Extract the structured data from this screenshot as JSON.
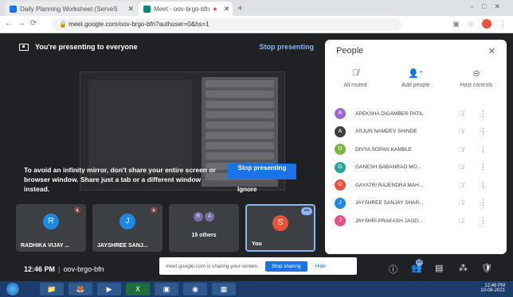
{
  "browser": {
    "tabs": [
      {
        "label": "Daily Planning Worksheet (ServeS"
      },
      {
        "label": "Meet - oov-brgo-bfn"
      }
    ],
    "url": "meet.google.com/oov-brgo-bfn?authuser=0&hs=1"
  },
  "meet": {
    "presenting_text": "You're presenting to everyone",
    "stop_presenting_label": "Stop presenting",
    "mirror_warning": "To avoid an infinity mirror, don't share your entire screen or browser window. Share just a tab or a different window instead.",
    "stop_button": "Stop presenting",
    "ignore_label": "Ignore",
    "tiles": [
      {
        "initial": "R",
        "name": "RADHIKA VIJAY ...",
        "color": "#1e88e5"
      },
      {
        "initial": "J",
        "name": "JAYSHREE SANJ...",
        "color": "#1e88e5"
      },
      {
        "others": "15 others",
        "mini": [
          "R",
          "A"
        ]
      },
      {
        "initial": "S",
        "name": "You",
        "color": "#e8533a"
      }
    ],
    "time": "12:46 PM",
    "meeting_code": "oov-brgo-bfn",
    "share_notice": "meet.google.com is sharing your screen.",
    "share_stop": "Stop sharing",
    "share_hide": "Hide",
    "people_badge": "18"
  },
  "people_panel": {
    "title": "People",
    "actions": [
      {
        "label": "All muted"
      },
      {
        "label": "Add people"
      },
      {
        "label": "Host controls"
      }
    ],
    "people": [
      {
        "initial": "A",
        "name": "APEKSHA DIGAMBER PATIL",
        "color": "#9c6bd0"
      },
      {
        "initial": "A",
        "name": "ARJUN NAMDEV SHINDE",
        "color": "#3c4043"
      },
      {
        "initial": "D",
        "name": "DIVYA SOPAN KAMBLE",
        "color": "#7cb342"
      },
      {
        "initial": "G",
        "name": "GANESH BABANRAO MO...",
        "color": "#26a69a"
      },
      {
        "initial": "G",
        "name": "GAYATRI RAJENDRA MAH...",
        "color": "#e8533a"
      },
      {
        "initial": "J",
        "name": "JAYSHREE SANJAY SHAR...",
        "color": "#1e88e5"
      },
      {
        "initial": "J",
        "name": "JAYSHRI PRAKASH JAGD...",
        "color": "#e8508a"
      }
    ]
  },
  "taskbar": {
    "clock_time": "12:46 PM",
    "clock_date": "10-08-2021"
  }
}
